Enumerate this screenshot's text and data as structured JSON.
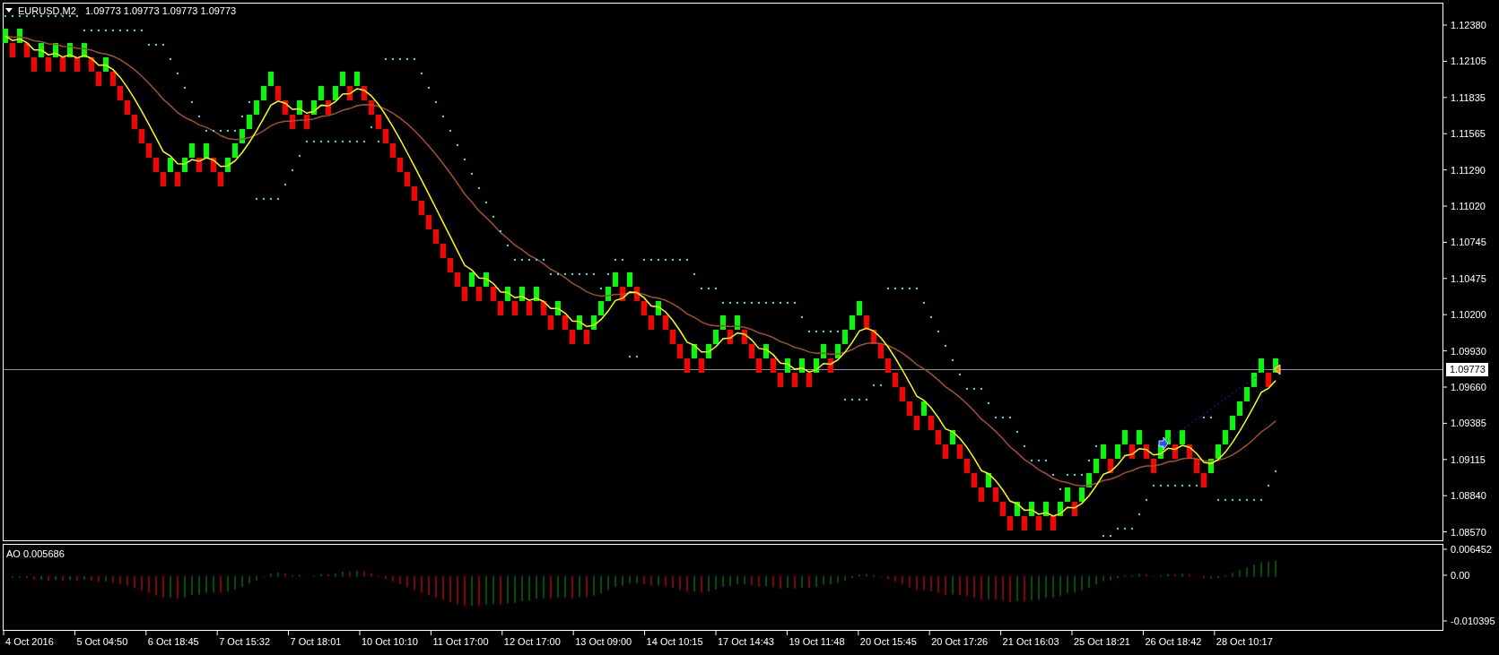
{
  "chart_header": {
    "symbol": "EURUSD,M2",
    "values": "1.09773 1.09773 1.09773 1.09773"
  },
  "price_axis": [
    "1.12380",
    "1.12105",
    "1.11835",
    "1.11565",
    "1.11290",
    "1.11020",
    "1.10745",
    "1.10475",
    "1.10200",
    "1.09930",
    "1.09660",
    "1.09385",
    "1.09115",
    "1.08840",
    "1.08570"
  ],
  "current_price": "1.09773",
  "ao_panel": {
    "label": "AO 0.005686",
    "axis": [
      "0.006452",
      "0.00",
      "-0.010395"
    ]
  },
  "time_axis": [
    "4 Oct 2016",
    "5 Oct 04:50",
    "6 Oct 18:45",
    "7 Oct 15:32",
    "7 Oct 18:01",
    "10 Oct 10:10",
    "11 Oct 17:00",
    "12 Oct 17:00",
    "13 Oct 09:00",
    "14 Oct 10:15",
    "17 Oct 14:43",
    "19 Oct 11:48",
    "20 Oct 15:45",
    "20 Oct 17:26",
    "21 Oct 16:03",
    "25 Oct 18:21",
    "26 Oct 18:42",
    "28 Oct 10:17"
  ]
}
